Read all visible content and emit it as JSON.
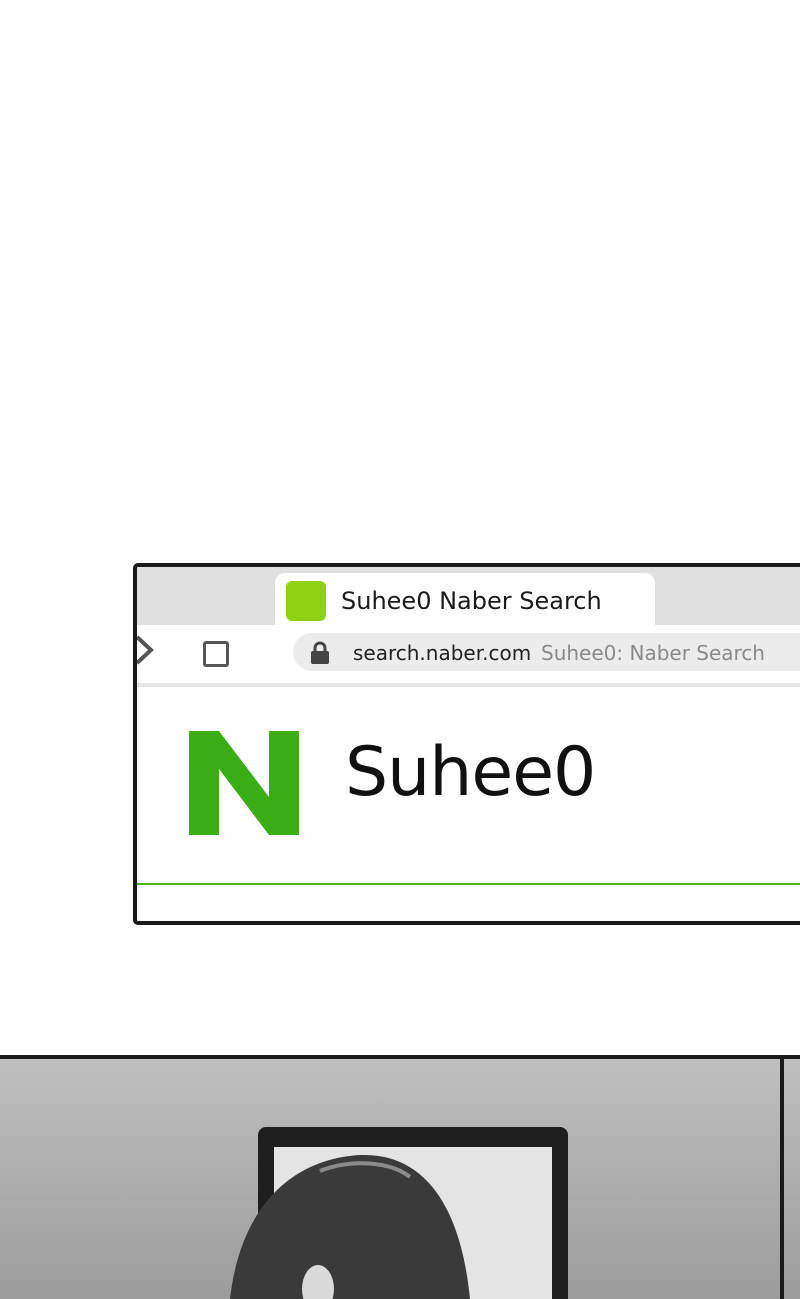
{
  "browser": {
    "tab": {
      "title": "Suhee0 Naber Search",
      "favicon_icon": "square-favicon-icon",
      "favicon_color": "#8fd213"
    },
    "toolbar": {
      "forward_icon": "chevron-right-icon",
      "stop_icon": "square-stop-icon"
    },
    "address_bar": {
      "lock_icon": "lock-icon",
      "url": "search.naber.com",
      "page_title": "Suhee0: Naber Search"
    },
    "content": {
      "logo_letter": "N",
      "logo_color": "#3aac14",
      "query": "Suhee0",
      "underline_color": "#4ab31d"
    }
  }
}
